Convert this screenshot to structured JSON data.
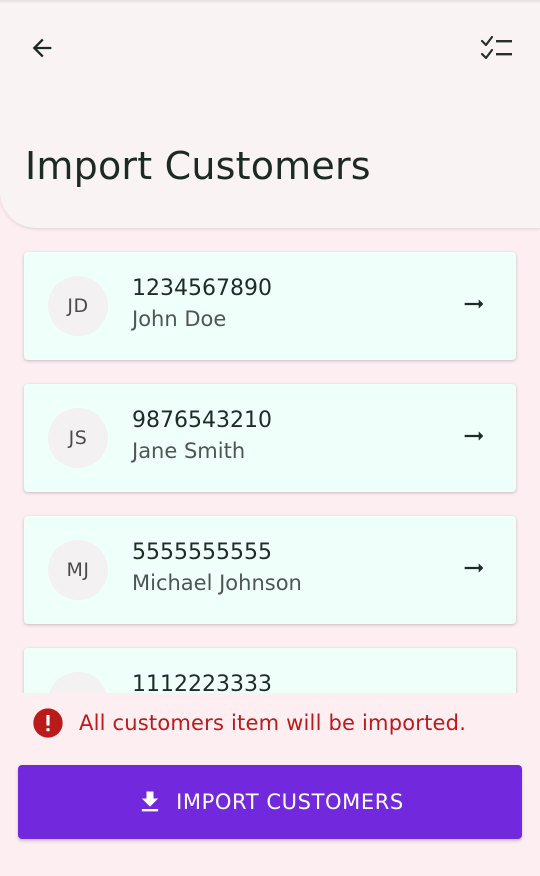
{
  "header": {
    "title": "Import Customers",
    "back_icon": "arrow-back-icon",
    "action_icon": "checklist-icon"
  },
  "customers": [
    {
      "initials": "JD",
      "phone": "1234567890",
      "name": "John Doe"
    },
    {
      "initials": "JS",
      "phone": "9876543210",
      "name": "Jane Smith"
    },
    {
      "initials": "MJ",
      "phone": "5555555555",
      "name": "Michael Johnson"
    },
    {
      "initials": "",
      "phone": "1112223333",
      "name": ""
    }
  ],
  "notice": {
    "text": "All customers item will be imported.",
    "icon": "error-icon",
    "color": "#ba1a1a"
  },
  "import_button": {
    "label": "IMPORT CUSTOMERS",
    "icon": "download-icon",
    "color": "#7229de"
  }
}
